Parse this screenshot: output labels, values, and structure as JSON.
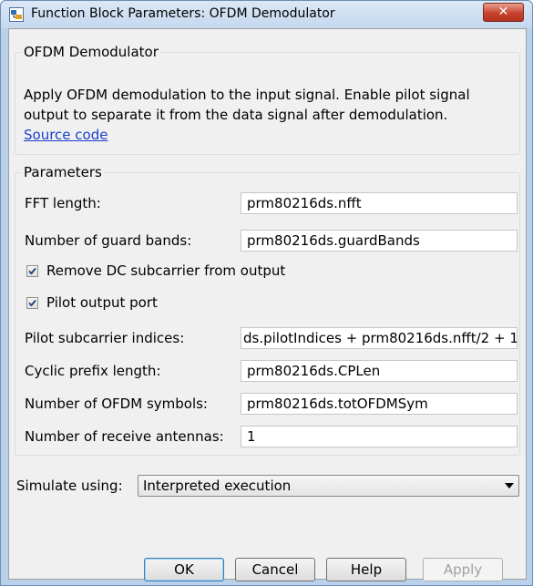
{
  "window": {
    "title": "Function Block Parameters: OFDM Demodulator",
    "close_label": "✕"
  },
  "block": {
    "group_title": "OFDM Demodulator",
    "description": "Apply OFDM demodulation to the input signal. Enable pilot signal output to separate it from the data signal after demodulation.",
    "source_link": "Source code"
  },
  "parameters": {
    "group_title": "Parameters",
    "fft_length": {
      "label": "FFT length:",
      "value": "prm80216ds.nfft"
    },
    "guard_bands": {
      "label": "Number of guard bands:",
      "value": "prm80216ds.guardBands"
    },
    "remove_dc": {
      "label": "Remove DC subcarrier from output",
      "checked": true
    },
    "pilot_port": {
      "label": "Pilot output port",
      "checked": true
    },
    "pilot_indices": {
      "label": "Pilot subcarrier indices:",
      "value": "ds.pilotIndices + prm80216ds.nfft/2 + 1"
    },
    "cp_length": {
      "label": "Cyclic prefix length:",
      "value": "prm80216ds.CPLen"
    },
    "ofdm_symbols": {
      "label": "Number of OFDM symbols:",
      "value": "prm80216ds.totOFDMSym"
    },
    "rx_antennas": {
      "label": "Number of receive antennas:",
      "value": "1"
    }
  },
  "simulate": {
    "label": "Simulate using:",
    "selected": "Interpreted execution"
  },
  "buttons": {
    "ok": "OK",
    "cancel": "Cancel",
    "help": "Help",
    "apply": "Apply"
  },
  "colors": {
    "link": "#1a3fcc",
    "title_bar": "#c4d8ee",
    "close_button": "#c8432f"
  }
}
